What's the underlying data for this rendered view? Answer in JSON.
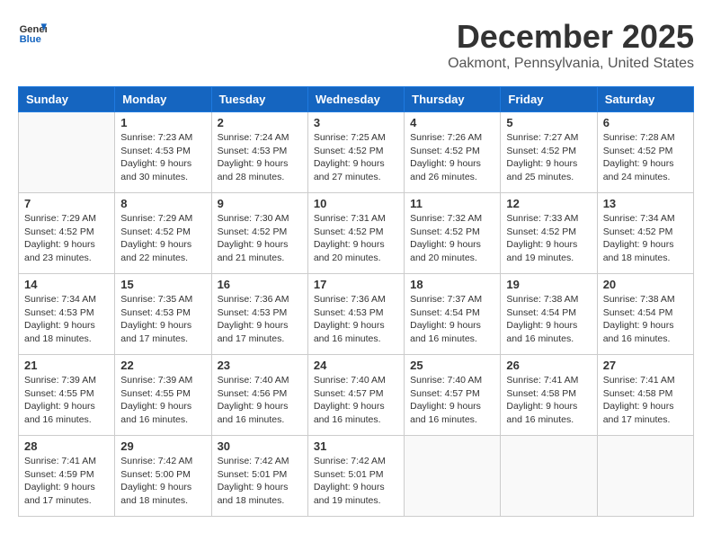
{
  "header": {
    "logo_line1": "General",
    "logo_line2": "Blue",
    "month_title": "December 2025",
    "location": "Oakmont, Pennsylvania, United States"
  },
  "days_of_week": [
    "Sunday",
    "Monday",
    "Tuesday",
    "Wednesday",
    "Thursday",
    "Friday",
    "Saturday"
  ],
  "weeks": [
    [
      {
        "day": "",
        "info": ""
      },
      {
        "day": "1",
        "info": "Sunrise: 7:23 AM\nSunset: 4:53 PM\nDaylight: 9 hours\nand 30 minutes."
      },
      {
        "day": "2",
        "info": "Sunrise: 7:24 AM\nSunset: 4:53 PM\nDaylight: 9 hours\nand 28 minutes."
      },
      {
        "day": "3",
        "info": "Sunrise: 7:25 AM\nSunset: 4:52 PM\nDaylight: 9 hours\nand 27 minutes."
      },
      {
        "day": "4",
        "info": "Sunrise: 7:26 AM\nSunset: 4:52 PM\nDaylight: 9 hours\nand 26 minutes."
      },
      {
        "day": "5",
        "info": "Sunrise: 7:27 AM\nSunset: 4:52 PM\nDaylight: 9 hours\nand 25 minutes."
      },
      {
        "day": "6",
        "info": "Sunrise: 7:28 AM\nSunset: 4:52 PM\nDaylight: 9 hours\nand 24 minutes."
      }
    ],
    [
      {
        "day": "7",
        "info": "Sunrise: 7:29 AM\nSunset: 4:52 PM\nDaylight: 9 hours\nand 23 minutes."
      },
      {
        "day": "8",
        "info": "Sunrise: 7:29 AM\nSunset: 4:52 PM\nDaylight: 9 hours\nand 22 minutes."
      },
      {
        "day": "9",
        "info": "Sunrise: 7:30 AM\nSunset: 4:52 PM\nDaylight: 9 hours\nand 21 minutes."
      },
      {
        "day": "10",
        "info": "Sunrise: 7:31 AM\nSunset: 4:52 PM\nDaylight: 9 hours\nand 20 minutes."
      },
      {
        "day": "11",
        "info": "Sunrise: 7:32 AM\nSunset: 4:52 PM\nDaylight: 9 hours\nand 20 minutes."
      },
      {
        "day": "12",
        "info": "Sunrise: 7:33 AM\nSunset: 4:52 PM\nDaylight: 9 hours\nand 19 minutes."
      },
      {
        "day": "13",
        "info": "Sunrise: 7:34 AM\nSunset: 4:52 PM\nDaylight: 9 hours\nand 18 minutes."
      }
    ],
    [
      {
        "day": "14",
        "info": "Sunrise: 7:34 AM\nSunset: 4:53 PM\nDaylight: 9 hours\nand 18 minutes."
      },
      {
        "day": "15",
        "info": "Sunrise: 7:35 AM\nSunset: 4:53 PM\nDaylight: 9 hours\nand 17 minutes."
      },
      {
        "day": "16",
        "info": "Sunrise: 7:36 AM\nSunset: 4:53 PM\nDaylight: 9 hours\nand 17 minutes."
      },
      {
        "day": "17",
        "info": "Sunrise: 7:36 AM\nSunset: 4:53 PM\nDaylight: 9 hours\nand 16 minutes."
      },
      {
        "day": "18",
        "info": "Sunrise: 7:37 AM\nSunset: 4:54 PM\nDaylight: 9 hours\nand 16 minutes."
      },
      {
        "day": "19",
        "info": "Sunrise: 7:38 AM\nSunset: 4:54 PM\nDaylight: 9 hours\nand 16 minutes."
      },
      {
        "day": "20",
        "info": "Sunrise: 7:38 AM\nSunset: 4:54 PM\nDaylight: 9 hours\nand 16 minutes."
      }
    ],
    [
      {
        "day": "21",
        "info": "Sunrise: 7:39 AM\nSunset: 4:55 PM\nDaylight: 9 hours\nand 16 minutes."
      },
      {
        "day": "22",
        "info": "Sunrise: 7:39 AM\nSunset: 4:55 PM\nDaylight: 9 hours\nand 16 minutes."
      },
      {
        "day": "23",
        "info": "Sunrise: 7:40 AM\nSunset: 4:56 PM\nDaylight: 9 hours\nand 16 minutes."
      },
      {
        "day": "24",
        "info": "Sunrise: 7:40 AM\nSunset: 4:57 PM\nDaylight: 9 hours\nand 16 minutes."
      },
      {
        "day": "25",
        "info": "Sunrise: 7:40 AM\nSunset: 4:57 PM\nDaylight: 9 hours\nand 16 minutes."
      },
      {
        "day": "26",
        "info": "Sunrise: 7:41 AM\nSunset: 4:58 PM\nDaylight: 9 hours\nand 16 minutes."
      },
      {
        "day": "27",
        "info": "Sunrise: 7:41 AM\nSunset: 4:58 PM\nDaylight: 9 hours\nand 17 minutes."
      }
    ],
    [
      {
        "day": "28",
        "info": "Sunrise: 7:41 AM\nSunset: 4:59 PM\nDaylight: 9 hours\nand 17 minutes."
      },
      {
        "day": "29",
        "info": "Sunrise: 7:42 AM\nSunset: 5:00 PM\nDaylight: 9 hours\nand 18 minutes."
      },
      {
        "day": "30",
        "info": "Sunrise: 7:42 AM\nSunset: 5:01 PM\nDaylight: 9 hours\nand 18 minutes."
      },
      {
        "day": "31",
        "info": "Sunrise: 7:42 AM\nSunset: 5:01 PM\nDaylight: 9 hours\nand 19 minutes."
      },
      {
        "day": "",
        "info": ""
      },
      {
        "day": "",
        "info": ""
      },
      {
        "day": "",
        "info": ""
      }
    ]
  ]
}
